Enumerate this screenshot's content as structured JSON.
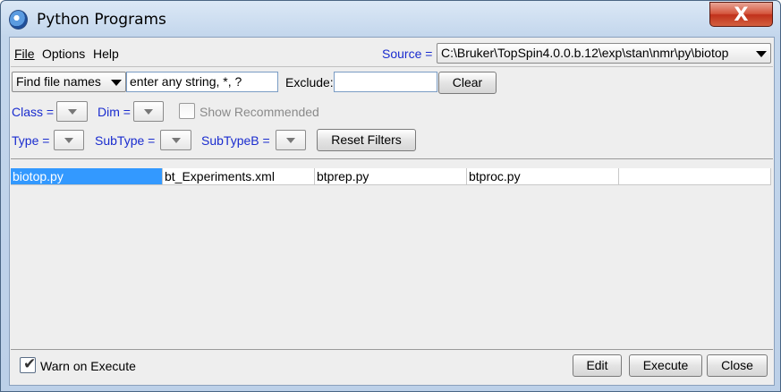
{
  "window": {
    "title": "Python Programs",
    "close_label": "X"
  },
  "menubar": {
    "file": "File",
    "options": "Options",
    "help": "Help"
  },
  "source": {
    "label": "Source =",
    "value": "C:\\Bruker\\TopSpin4.0.0.b.12\\exp\\stan\\nmr\\py\\biotop"
  },
  "search": {
    "mode": "Find file names",
    "placeholder": "enter any string, *, ?",
    "exclude_label": "Exclude:",
    "exclude_value": "",
    "clear_label": "Clear"
  },
  "filters": {
    "class_label": "Class =",
    "dim_label": "Dim =",
    "show_recommended": "Show Recommended",
    "type_label": "Type =",
    "subtype_label": "SubType =",
    "subtypeb_label": "SubTypeB =",
    "reset_label": "Reset Filters"
  },
  "files": [
    "biotop.py",
    "bt_Experiments.xml",
    "btprep.py",
    "btproc.py",
    ""
  ],
  "footer": {
    "warn_label": "Warn on Execute",
    "warn_checked": true,
    "edit_label": "Edit",
    "execute_label": "Execute",
    "close_label": "Close"
  }
}
